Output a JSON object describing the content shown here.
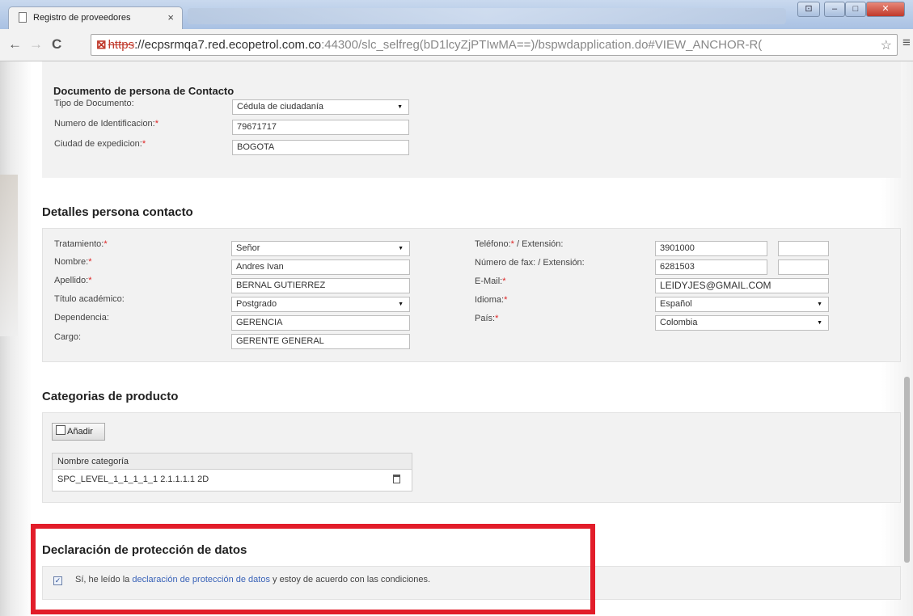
{
  "browser": {
    "tab_title": "Registro de proveedores",
    "tab_close": "×",
    "url_protocol": "https",
    "url_rest": "://ecpsrmqa7.red.ecopetrol.com.co",
    "url_tail": ":44300/slc_selfreg(bD1lcyZjPTIwMA==)/bspwdapplication.do#VIEW_ANCHOR-R("
  },
  "contact_document": {
    "title": "Documento de persona de Contacto",
    "fields": [
      {
        "label": "Tipo de Documento:",
        "required": false,
        "value": "Cédula de ciudadanía"
      },
      {
        "label": "Numero de Identificacion:",
        "required": true,
        "value": "79671717"
      },
      {
        "label": "Ciudad de expedicion:",
        "required": true,
        "value": "BOGOTA"
      }
    ]
  },
  "contact_details": {
    "title": "Detalles persona contacto",
    "left": [
      {
        "label": "Tratamiento:",
        "required": true,
        "value": "Señor"
      },
      {
        "label": "Nombre:",
        "required": true,
        "value": "Andres Ivan"
      },
      {
        "label": "Apellido:",
        "required": true,
        "value": "BERNAL GUTIERREZ"
      },
      {
        "label": "Título académico:",
        "required": false,
        "value": "Postgrado"
      },
      {
        "label": "Dependencia:",
        "required": false,
        "value": "GERENCIA"
      },
      {
        "label": "Cargo:",
        "required": false,
        "value": "GERENTE GENERAL"
      }
    ],
    "right": [
      {
        "label": "Teléfono:",
        "suffix": " / Extensión:",
        "required": true,
        "value": "3901000",
        "ext": ""
      },
      {
        "label": "Número de fax:",
        "suffix": " / Extensión:",
        "required": false,
        "value": "6281503",
        "ext": ""
      },
      {
        "label": "E-Mail:",
        "suffix": "",
        "required": true,
        "value": "LEIDYJES@GMAIL.COM"
      },
      {
        "label": "Idioma:",
        "suffix": "",
        "required": true,
        "value": "Español"
      },
      {
        "label": "País:",
        "suffix": "",
        "required": true,
        "value": "Colombia"
      }
    ]
  },
  "categories": {
    "title": "Categorias de producto",
    "add_label": "Añadir",
    "column_header": "Nombre categoría",
    "rows": [
      "SPC_LEVEL_1_1_1_1_1 2.1.1.1.1 2D"
    ]
  },
  "privacy": {
    "title": "Declaración de protección de datos",
    "checked": true,
    "check_mark": "✓",
    "text_before": "Sí, he leído la ",
    "link_text": "declaración de protección de datos",
    "text_after": " y estoy de acuerdo con las condiciones."
  },
  "colors": {
    "highlight_border": "#e21d2a",
    "link": "#3a63b8",
    "required": "#d22"
  }
}
